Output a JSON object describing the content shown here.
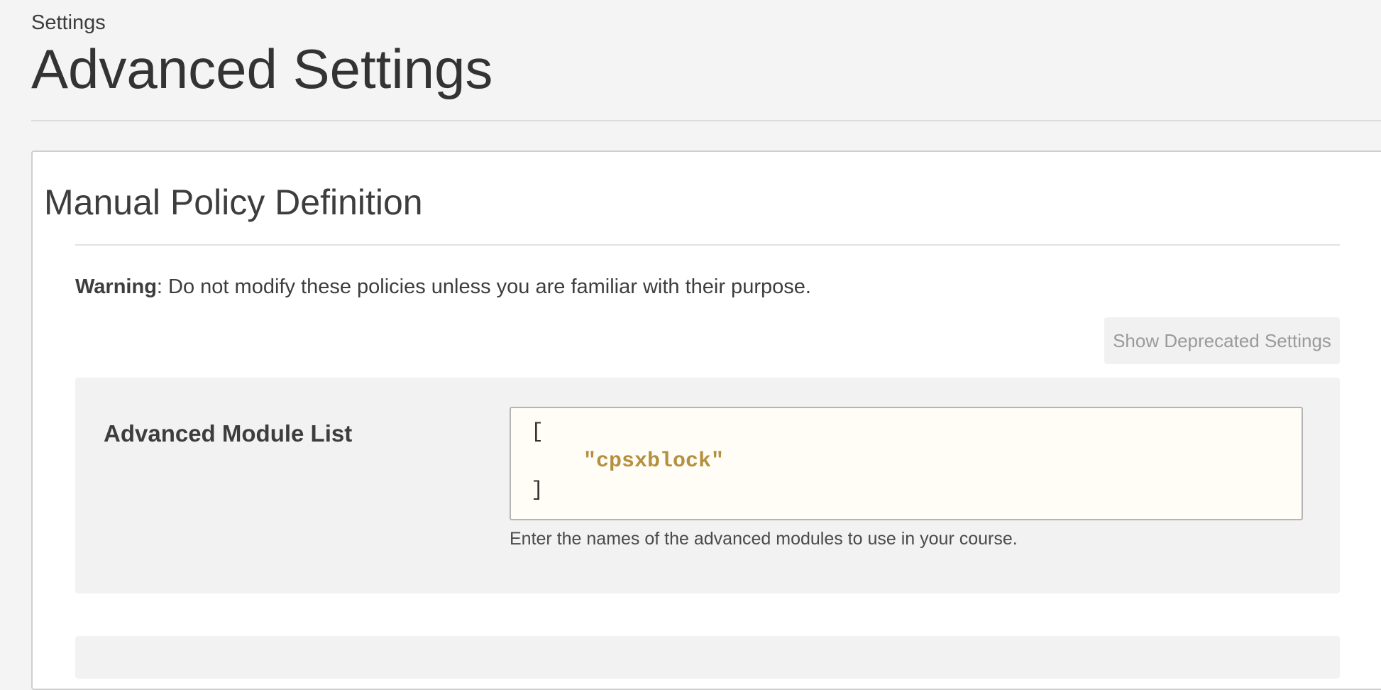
{
  "header": {
    "breadcrumb": "Settings",
    "title": "Advanced Settings"
  },
  "policy_section": {
    "title": "Manual Policy Definition",
    "warning_label": "Warning",
    "warning_text": ": Do not modify these policies unless you are familiar with their purpose.",
    "deprecated_button_label": "Show Deprecated Settings"
  },
  "fields": [
    {
      "label": "Advanced Module List",
      "value_lines": [
        "[",
        "\"cpsxblock\"",
        "]"
      ],
      "help": "Enter the names of the advanced modules to use in your course."
    }
  ],
  "colors": {
    "page_background": "#f4f4f4",
    "card_background": "#ffffff",
    "field_panel": "#f2f2f2",
    "editor_background": "#fffdf6",
    "string_literal": "#b59040",
    "muted_button_text": "#9a9a9a"
  }
}
